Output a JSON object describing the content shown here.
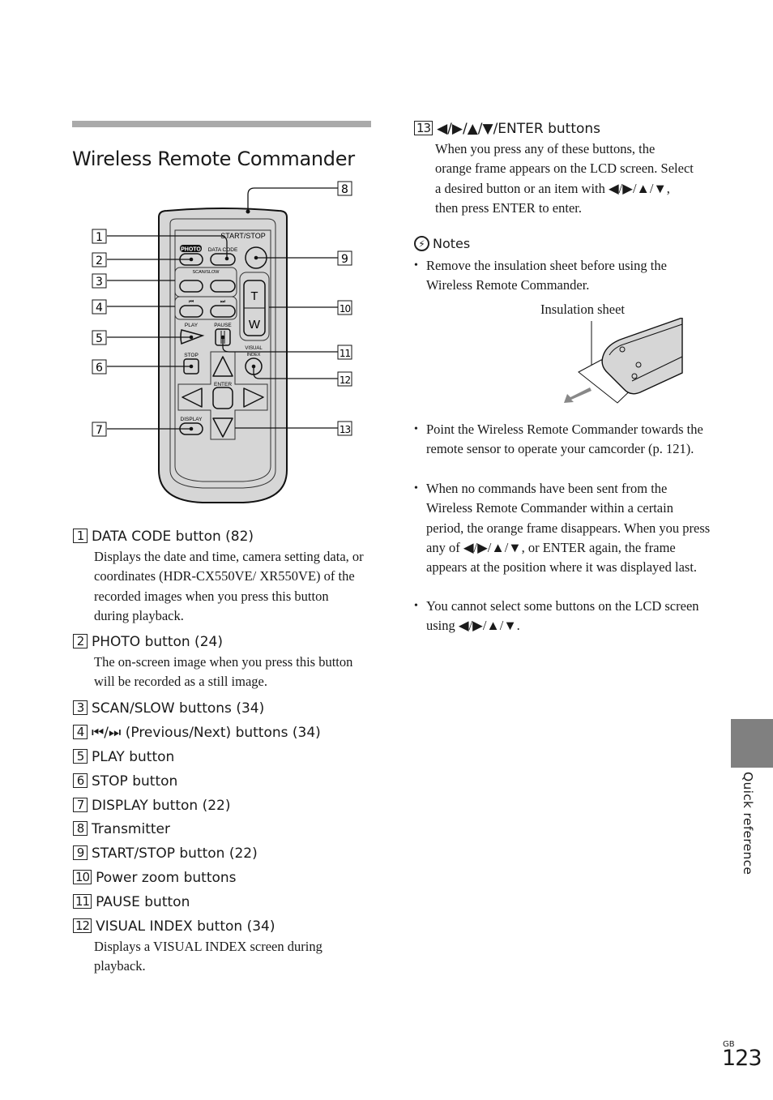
{
  "section": {
    "title": "Wireless Remote Commander"
  },
  "diagram": {
    "callouts": [
      "1",
      "2",
      "3",
      "4",
      "5",
      "6",
      "7",
      "8",
      "9",
      "10",
      "11",
      "12",
      "13"
    ],
    "remote_labels": {
      "start_stop": "START/STOP",
      "photo": "PHOTO",
      "data_code": "DATA CODE",
      "scan_slow": "SCAN/SLOW",
      "play": "PLAY",
      "pause": "PAUSE",
      "stop": "STOP",
      "visual": "VISUAL",
      "index": "INDEX",
      "enter": "ENTER",
      "display": "DISPLAY",
      "zoom_t": "T",
      "zoom_w": "W",
      "prev": "⏮",
      "next": "⏭"
    }
  },
  "items": [
    {
      "num": "1",
      "title": "DATA CODE button (82)",
      "desc": "Displays the date and time, camera setting data, or coordinates (HDR-CX550VE/ XR550VE) of the recorded images when you press this button during playback."
    },
    {
      "num": "2",
      "title": "PHOTO button (24)",
      "desc": "The on-screen image when you press this button will be recorded as a still image."
    },
    {
      "num": "3",
      "title": "SCAN/SLOW buttons (34)",
      "desc": ""
    },
    {
      "num": "4",
      "title": "⏮/⏭ (Previous/Next) buttons (34)",
      "desc": ""
    },
    {
      "num": "5",
      "title": "PLAY button",
      "desc": ""
    },
    {
      "num": "6",
      "title": "STOP button",
      "desc": ""
    },
    {
      "num": "7",
      "title": "DISPLAY button (22)",
      "desc": ""
    },
    {
      "num": "8",
      "title": "Transmitter",
      "desc": ""
    },
    {
      "num": "9",
      "title": "START/STOP button (22)",
      "desc": ""
    },
    {
      "num": "10",
      "title": "Power zoom buttons",
      "desc": ""
    },
    {
      "num": "11",
      "title": "PAUSE button",
      "desc": ""
    },
    {
      "num": "12",
      "title": "VISUAL INDEX button (34)",
      "desc": "Displays a VISUAL INDEX screen during playback."
    },
    {
      "num": "13",
      "title": "◀/▶/▲/▼/ENTER buttons",
      "desc": "When you press any of these buttons, the orange frame appears on the LCD screen. Select a desired button or an item with ◀/▶/▲/▼, then press ENTER to enter."
    }
  ],
  "notes": {
    "heading": "Notes",
    "bullets": [
      "Remove the insulation sheet before using the Wireless Remote Commander.",
      "Point the Wireless Remote Commander towards the remote sensor to operate your camcorder (p. 121).",
      "When no commands have been sent from the Wireless Remote Commander within a certain period, the orange frame disappears. When you press any of ◀/▶/▲/▼, or ENTER again, the frame appears at the position where it was displayed last.",
      "You cannot select some buttons on the LCD screen using ◀/▶/▲/▼."
    ],
    "insulation_label": "Insulation sheet"
  },
  "sidebar": {
    "section_label": "Quick reference",
    "tab_color": "#808080"
  },
  "footer": {
    "region": "GB",
    "page_number": "123"
  }
}
